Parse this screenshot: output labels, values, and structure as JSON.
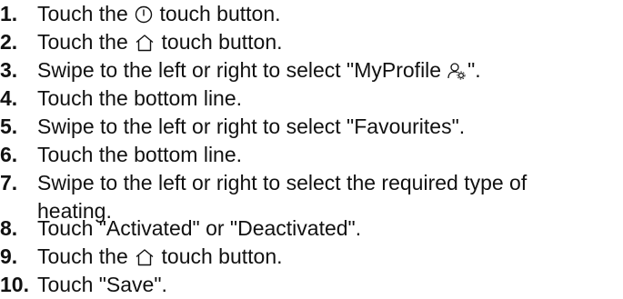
{
  "steps": [
    {
      "number": "1.",
      "before": "Touch the",
      "icon": "power-icon",
      "after": "touch button."
    },
    {
      "number": "2.",
      "before": "Touch the",
      "icon": "home-icon",
      "after": "touch button."
    },
    {
      "number": "3.",
      "before": "Swipe to the left or right to select \"MyProfile",
      "icon": "profile-settings-icon",
      "after": "\"."
    },
    {
      "number": "4.",
      "text": "Touch the bottom line."
    },
    {
      "number": "5.",
      "text": "Swipe to the left or right to select \"Favourites\"."
    },
    {
      "number": "6.",
      "text": "Touch the bottom line."
    },
    {
      "number": "7.",
      "text": "Swipe to the left or right to select the required type of",
      "text_line2": "heating."
    },
    {
      "number": "8.",
      "text": "Touch \"Activated\" or \"Deactivated\"."
    },
    {
      "number": "9.",
      "before": "Touch the",
      "icon": "home-icon",
      "after": "touch button."
    },
    {
      "number": "10.",
      "text": "Touch \"Save\"."
    }
  ]
}
